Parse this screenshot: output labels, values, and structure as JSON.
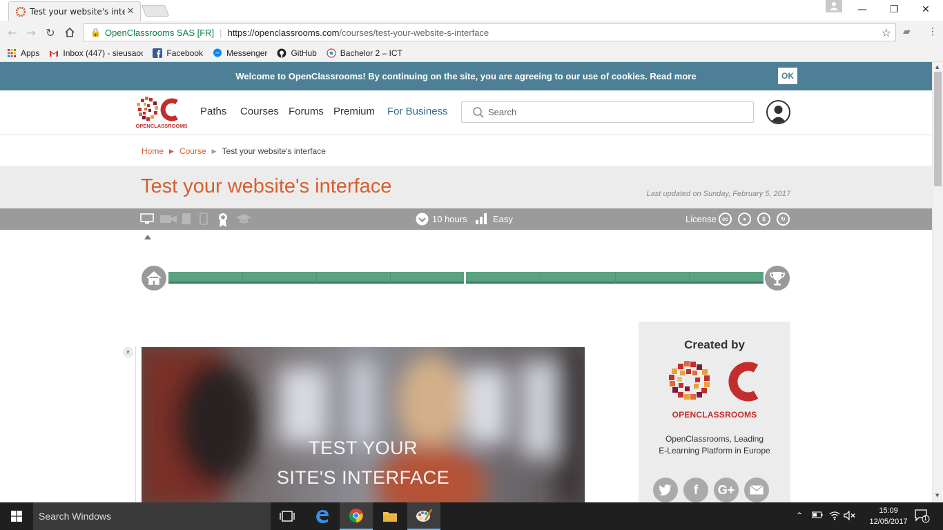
{
  "browser": {
    "tab_title": "Test your website's interfa",
    "tab_close": "✕",
    "window_controls": {
      "minimize": "—",
      "maximize": "❐",
      "close": "✕"
    },
    "address": {
      "ev_name": "OpenClassrooms SAS [FR]",
      "url_host": "https://openclassrooms.com",
      "url_path": "/courses/test-your-website-s-interface"
    },
    "bookmarks": [
      {
        "label": "Apps",
        "icon": "apps-grid-icon"
      },
      {
        "label": "Inbox (447) - sieusaoc",
        "icon": "gmail-icon"
      },
      {
        "label": "Facebook",
        "icon": "facebook-icon"
      },
      {
        "label": "Messenger",
        "icon": "messenger-icon"
      },
      {
        "label": "GitHub",
        "icon": "github-icon"
      },
      {
        "label": "Bachelor 2 – ICT",
        "icon": "bookmark-site-icon"
      }
    ]
  },
  "page": {
    "cookie": {
      "text": "Welcome to OpenClassrooms! By continuing on the site, you are agreeing to our use of cookies. Read more",
      "ok": "OK"
    },
    "nav": {
      "paths": "Paths",
      "courses": "Courses",
      "forums": "Forums",
      "premium": "Premium",
      "business": "For Business"
    },
    "search": {
      "placeholder": "Search"
    },
    "breadcrumb": {
      "home": "Home",
      "course": "Course",
      "current": "Test your website's interface"
    },
    "course": {
      "title": "Test your website's interface",
      "updated": "Last updated on Sunday, February 5, 2017",
      "duration": "10 hours",
      "difficulty": "Easy",
      "license": "License"
    },
    "progress": {
      "completed_segments": 8,
      "total_segments": 8
    },
    "video": {
      "line1": "TEST YOUR",
      "line2": "SITE'S INTERFACE",
      "anchor": "#"
    },
    "creator": {
      "heading": "Created by",
      "wordmark": "OPENCLASSROOMS",
      "desc_line1": "OpenClassrooms, Leading",
      "desc_line2": "E-Learning Platform in Europe"
    }
  },
  "taskbar": {
    "search_placeholder": "Search Windows",
    "time": "15:09",
    "date": "12/05/2017",
    "notification_count": "1"
  },
  "colors": {
    "accent": "#d65f30",
    "cookie_bar": "#4d8097",
    "progress_green": "#5aa380",
    "info_bar": "#9b9b9b"
  }
}
